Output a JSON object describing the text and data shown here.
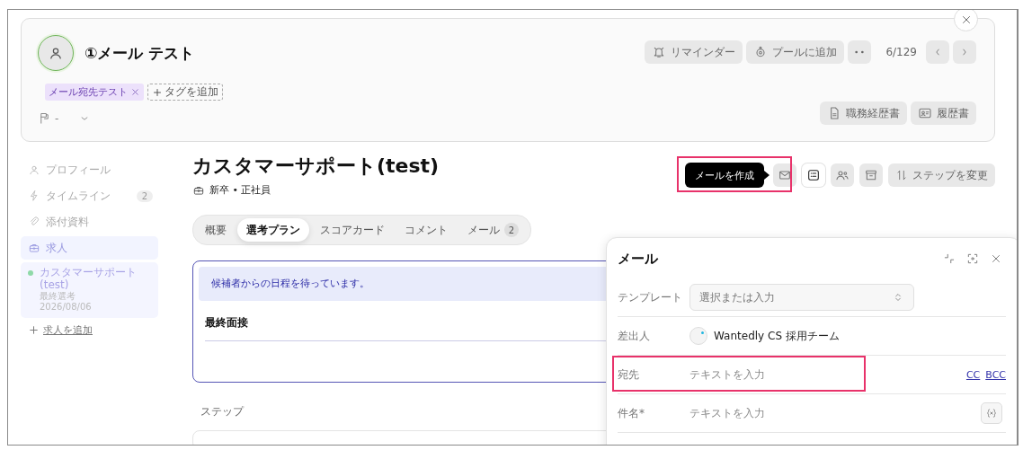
{
  "candidate": {
    "name": "①メール テスト",
    "tags": [
      {
        "label": "メール宛先テスト",
        "color": "#ece1fb"
      }
    ],
    "add_tag": "タグを追加",
    "flag": "-"
  },
  "header_actions": [
    {
      "kind": "bell",
      "label": "リマインダー"
    },
    {
      "kind": "pool",
      "label": "プールに追加"
    }
  ],
  "pager": "6/129",
  "documents": [
    {
      "kind": "doc",
      "label": "職務経歴書"
    },
    {
      "kind": "card",
      "label": "履歴書"
    }
  ],
  "sidebar": {
    "items": [
      {
        "kind": "profile",
        "label": "プロフィール",
        "selected": false
      },
      {
        "kind": "timeline",
        "label": "タイムライン",
        "badge": "2",
        "selected": false
      },
      {
        "kind": "attachment",
        "label": "添付資料",
        "selected": false
      },
      {
        "kind": "job",
        "label": "求人",
        "selected": true
      }
    ],
    "jobs": [
      {
        "title": "カスタマーサポート(test)",
        "stage": "最終選考",
        "date": "2026/08/06",
        "color": "#8fd9a8"
      }
    ],
    "add_job": "求人を追加"
  },
  "job": {
    "title": "カスタマーサポート(test)",
    "type": "新卒 • 正社員"
  },
  "actions": {
    "tooltip": "メールを作成",
    "buttons": [
      {
        "kind": "mail",
        "selected": false,
        "highlighted": true
      },
      {
        "kind": "checklist",
        "selected": true
      },
      {
        "kind": "people",
        "selected": false
      },
      {
        "kind": "archive",
        "selected": false
      }
    ],
    "change_step": "ステップを変更"
  },
  "tabs": [
    {
      "label": "概要",
      "selected": false
    },
    {
      "label": "選考プラン",
      "selected": true
    },
    {
      "label": "スコアカード",
      "selected": false
    },
    {
      "label": "コメント",
      "selected": false
    },
    {
      "label": "メール",
      "badge": "2",
      "selected": false
    }
  ],
  "plan": {
    "notice": "候補者からの日程を待っています。",
    "stage": "最終面接",
    "steps_heading": "ステップ"
  },
  "mail": {
    "title": "メール",
    "fields": [
      {
        "kind": "select",
        "label": "テンプレート",
        "placeholder": "選択または入力",
        "highlighted": false
      },
      {
        "kind": "sender",
        "label": "差出人",
        "value": "Wantedly CS 採用チーム",
        "highlighted": false
      },
      {
        "kind": "recipients",
        "label": "宛先",
        "placeholder": "テキストを入力",
        "links": [
          "CC",
          "BCC"
        ],
        "highlighted": true
      },
      {
        "kind": "subject",
        "label": "件名*",
        "placeholder": "テキストを入力",
        "highlighted": false
      }
    ]
  }
}
